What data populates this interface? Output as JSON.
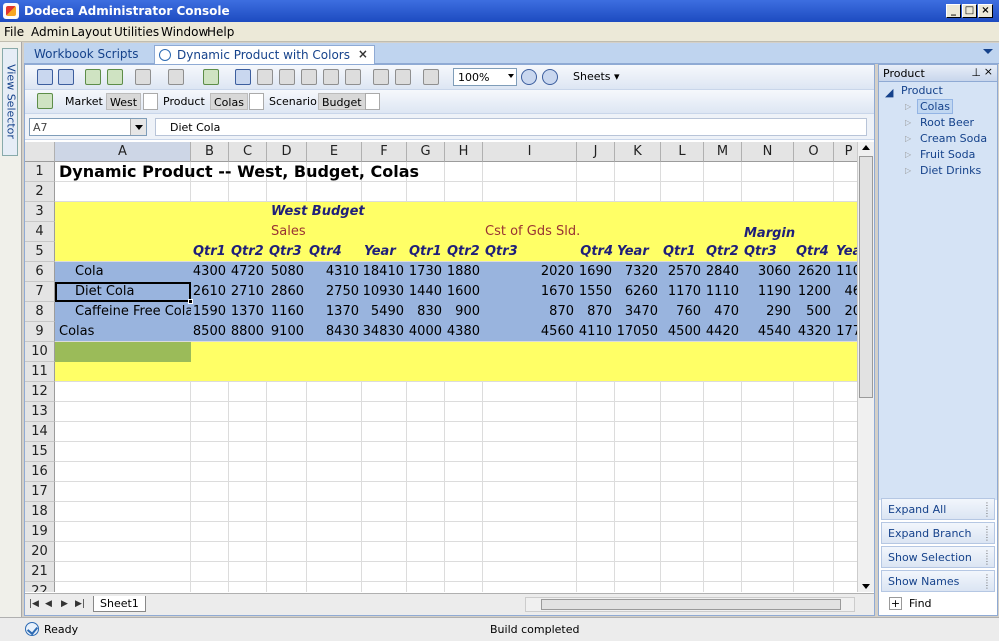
{
  "window": {
    "title": "Dodeca Administrator Console"
  },
  "menu": [
    "File",
    "Admin",
    "Layout",
    "Utilities",
    "Window",
    "Help"
  ],
  "left_strip_label": "View Selector",
  "tabs": [
    {
      "label": "Workbook Scripts",
      "active": false
    },
    {
      "label": "Dynamic Product with Colors",
      "active": true
    }
  ],
  "toolbar": {
    "zoom": "100%",
    "sheets_label": "Sheets"
  },
  "pov": [
    {
      "label": "Market",
      "value": "West"
    },
    {
      "label": "Product",
      "value": "Colas"
    },
    {
      "label": "Scenario",
      "value": "Budget"
    }
  ],
  "formula_bar": {
    "cell_ref": "A7",
    "content": "Diet Cola"
  },
  "columns": [
    "A",
    "B",
    "C",
    "D",
    "E",
    "F",
    "G",
    "H",
    "I",
    "J",
    "K",
    "L",
    "M",
    "N",
    "O",
    "P"
  ],
  "rows": [
    "1",
    "2",
    "3",
    "4",
    "5",
    "6",
    "7",
    "8",
    "9",
    "10",
    "11",
    "12",
    "13",
    "14",
    "15",
    "16",
    "17",
    "18",
    "19",
    "20",
    "21",
    "22"
  ],
  "sheet": {
    "title": "Dynamic Product -- West, Budget, Colas",
    "scenario_heading": "West  Budget",
    "sales_label": "Sales",
    "cogs_label": "Cst of Gds Sld.",
    "margin_label": "Margin",
    "period_headers": [
      "Qtr1",
      "Qtr2",
      "Qtr3",
      "Qtr4",
      "Year",
      "Qtr1",
      "Qtr2",
      "Qtr3",
      "Qtr4",
      "Year",
      "Qtr1",
      "Qtr2",
      "Qtr3",
      "Qtr4",
      "Yea"
    ],
    "data_rows": [
      {
        "label": "Cola",
        "values": [
          "4300",
          "4720",
          "5080",
          "4310",
          "18410",
          "1730",
          "1880",
          "2020",
          "1690",
          "7320",
          "2570",
          "2840",
          "3060",
          "2620",
          "110"
        ]
      },
      {
        "label": "Diet Cola",
        "values": [
          "2610",
          "2710",
          "2860",
          "2750",
          "10930",
          "1440",
          "1600",
          "1670",
          "1550",
          "6260",
          "1170",
          "1110",
          "1190",
          "1200",
          "46"
        ]
      },
      {
        "label": "Caffeine Free Cola",
        "values": [
          "1590",
          "1370",
          "1160",
          "1370",
          "5490",
          "830",
          "900",
          "870",
          "870",
          "3470",
          "760",
          "470",
          "290",
          "500",
          "20"
        ]
      },
      {
        "label": "Colas",
        "values": [
          "8500",
          "8800",
          "9100",
          "8430",
          "34830",
          "4000",
          "4380",
          "4560",
          "4110",
          "17050",
          "4500",
          "4420",
          "4540",
          "4320",
          "177"
        ]
      }
    ],
    "tab_name": "Sheet1"
  },
  "product_panel": {
    "title": "Product",
    "root": "Product",
    "children": [
      "Colas",
      "Root Beer",
      "Cream Soda",
      "Fruit Soda",
      "Diet Drinks"
    ],
    "buttons": [
      "Expand All",
      "Expand Branch",
      "Show Selection",
      "Show Names"
    ],
    "find_label": "Find"
  },
  "status": {
    "left": "Ready",
    "center": "Build completed"
  },
  "colors": {
    "yellow": "#ffff66",
    "blue": "#99b4de",
    "green": "#9bbb59",
    "maroon": "#993333",
    "navy": "#1f1f7a"
  }
}
